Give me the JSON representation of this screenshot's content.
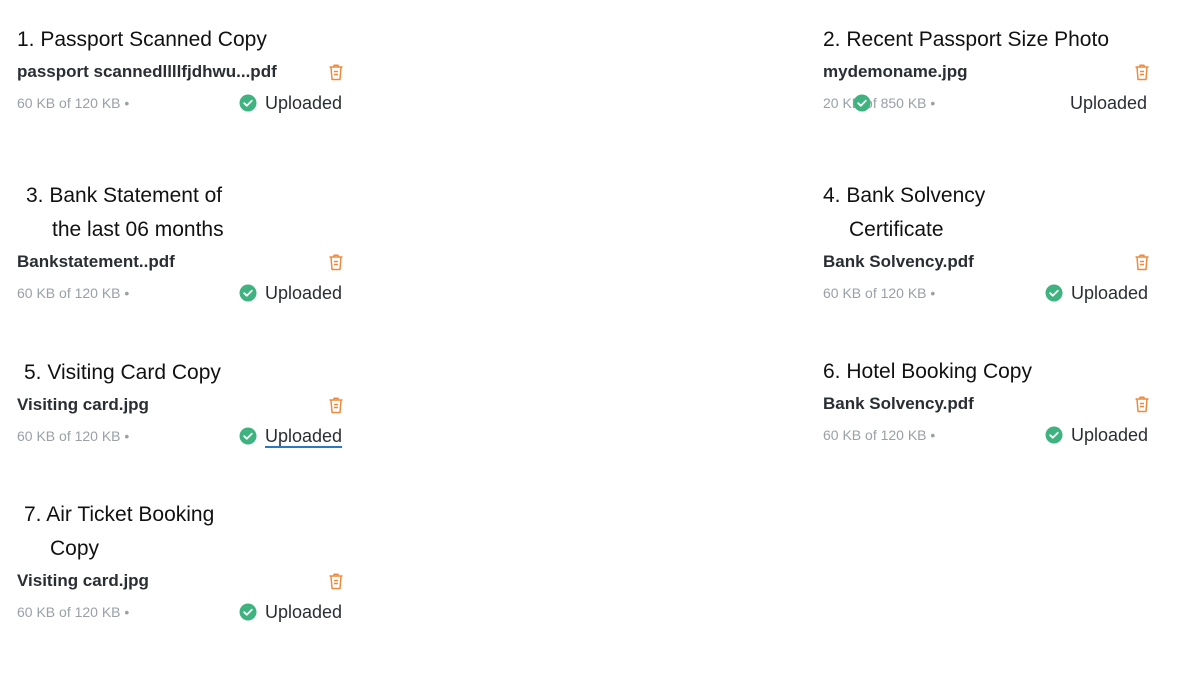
{
  "colors": {
    "accent_orange": "#ef8a3c",
    "success_green": "#3fb37f",
    "muted": "#9aa0a6",
    "link_blue": "#2b79c2"
  },
  "icons": {
    "delete": "trash-icon",
    "status": "check-circle-icon"
  },
  "documents": [
    {
      "num": "1.",
      "title": "Passport Scanned Copy",
      "file": "passport scannedllllfjdhwu...pdf",
      "size": "60 KB of 120 KB •",
      "status": "Uploaded"
    },
    {
      "num": "2.",
      "title": "Recent Passport Size Photo",
      "file": "mydemoname.jpg",
      "size": "20 KB of 850 KB •",
      "status": "Uploaded"
    },
    {
      "num": "3.",
      "title_lines": [
        "Bank Statement of",
        "the last 06 months"
      ],
      "file": "Bankstatement..pdf",
      "size": "60 KB of 120 KB •",
      "status": "Uploaded"
    },
    {
      "num": "4.",
      "title_lines": [
        "Bank Solvency",
        "Certificate"
      ],
      "file": "Bank Solvency.pdf",
      "size": "60 KB of 120 KB •",
      "status": "Uploaded"
    },
    {
      "num": "5.",
      "title": "Visiting Card Copy",
      "file": "Visiting card.jpg",
      "size": "60 KB of 120 KB •",
      "status": "Uploaded"
    },
    {
      "num": "6.",
      "title": "Hotel Booking Copy",
      "file": "Bank Solvency.pdf",
      "size": "60 KB of 120 KB •",
      "status": "Uploaded"
    },
    {
      "num": "7.",
      "title_lines": [
        "Air Ticket Booking",
        "Copy"
      ],
      "file": "Visiting card.jpg",
      "size": "60 KB of 120 KB •",
      "status": "Uploaded"
    }
  ]
}
